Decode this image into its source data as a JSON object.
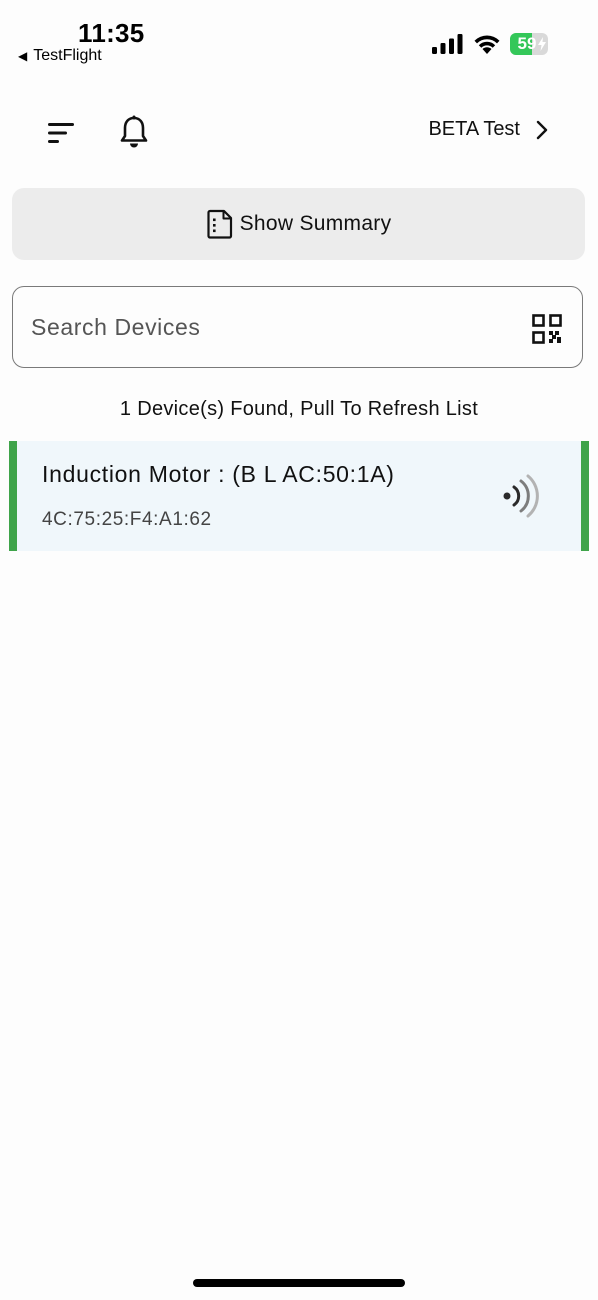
{
  "status_bar": {
    "time": "11:35",
    "back_app": "TestFlight",
    "battery_percent": "59",
    "battery_level": 0.59,
    "icons": [
      "signal-icon",
      "wifi-icon",
      "battery-icon",
      "charging-bolt-icon"
    ]
  },
  "header": {
    "menu_icon": "sort-menu-icon",
    "notification_icon": "bell-icon",
    "beta_label": "BETA Test",
    "beta_chevron": "chevron-right-icon"
  },
  "summary": {
    "label": "Show Summary",
    "icon": "document-icon"
  },
  "search": {
    "placeholder": "Search Devices",
    "value": "",
    "scan_icon": "qr-code-icon"
  },
  "results": {
    "status_text": "1 Device(s) Found, Pull To Refresh List",
    "devices": [
      {
        "name": "Induction Motor : (B L AC:50:1A)",
        "address": "4C:75:25:F4:A1:62",
        "icon": "broadcast-signal-icon"
      }
    ]
  },
  "colors": {
    "accent_green": "#3fa44a",
    "row_background": "#f0f7fb",
    "button_background": "#ececec",
    "battery_green": "#34c759"
  }
}
